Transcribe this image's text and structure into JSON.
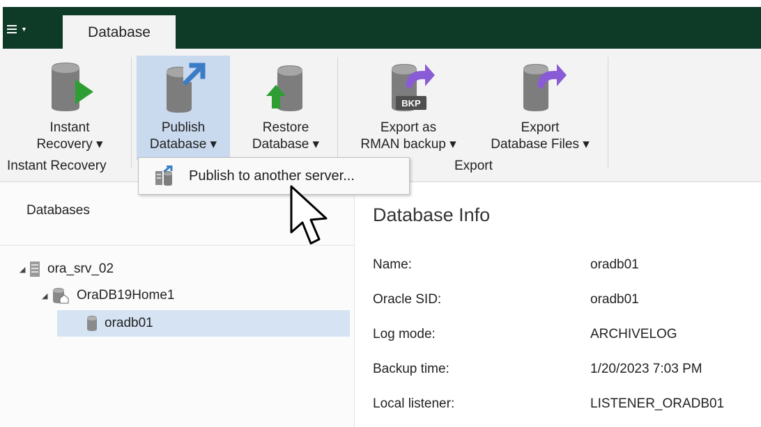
{
  "colors": {
    "titlebar": "#0e3a28",
    "ribbon": "#f3f3f3",
    "selected": "#c9d9ee",
    "tree_selected": "#d5e3f3",
    "accent_green": "#2e9e34",
    "accent_blue": "#3a7cc6",
    "accent_purple": "#8a5bd6"
  },
  "app_menu": {
    "icon": "hamburger-menu-icon"
  },
  "tabs": [
    {
      "label": "Database"
    }
  ],
  "ribbon": {
    "buttons": {
      "instant_recovery": {
        "line1": "Instant",
        "line2": "Recovery ▾",
        "icon": "database-play-icon"
      },
      "publish_database": {
        "line1": "Publish",
        "line2": "Database ▾",
        "icon": "database-publish-icon"
      },
      "restore_database": {
        "line1": "Restore",
        "line2": "Database ▾",
        "icon": "database-restore-icon"
      },
      "export_rman": {
        "line1": "Export as",
        "line2": "RMAN backup ▾",
        "icon": "database-export-bkp-icon",
        "badge": "BKP"
      },
      "export_files": {
        "line1": "Export",
        "line2": "Database Files ▾",
        "icon": "database-export-icon"
      }
    },
    "groups": {
      "instant_recovery": "Instant Recovery",
      "export": "Export"
    }
  },
  "dropdown": {
    "items": [
      {
        "label": "Publish to another server...",
        "icon": "publish-server-icon"
      }
    ]
  },
  "databases_panel": {
    "title": "Databases",
    "tree": [
      {
        "label": "ora_srv_02",
        "icon": "server-icon",
        "expanded": true
      },
      {
        "label": "OraDB19Home1",
        "icon": "oracle-home-icon",
        "expanded": true
      },
      {
        "label": "oradb01",
        "icon": "database-icon",
        "selected": true
      }
    ]
  },
  "info_panel": {
    "title": "Database Info",
    "rows": [
      {
        "key": "Name:",
        "value": "oradb01"
      },
      {
        "key": "Oracle SID:",
        "value": "oradb01"
      },
      {
        "key": "Log mode:",
        "value": "ARCHIVELOG"
      },
      {
        "key": "Backup time:",
        "value": "1/20/2023 7:03 PM"
      },
      {
        "key": "Local listener:",
        "value": "LISTENER_ORADB01"
      }
    ]
  }
}
